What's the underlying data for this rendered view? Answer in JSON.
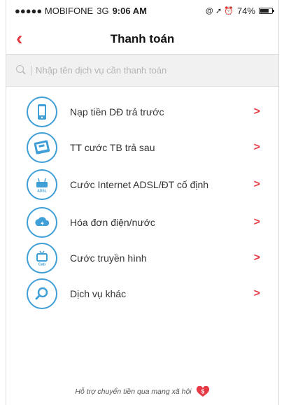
{
  "status": {
    "carrier": "●●●●● MOBIFONE",
    "network": "3G",
    "time": "9:06 AM",
    "icons": "@ ➚ ⏰",
    "battery": "74%",
    "battery_level": 0.74
  },
  "header": {
    "title": "Thanh toán",
    "back_icon": "chevron-left-icon"
  },
  "search": {
    "placeholder": "Nhập tên dịch vụ cần thanh toán"
  },
  "menu": [
    {
      "label": "Nạp tiền DĐ trả trước",
      "icon": "phone-icon"
    },
    {
      "label": "TT cước TB trả sau",
      "icon": "tablet-icon"
    },
    {
      "label": "Cước Internet ADSL/ĐT cố định",
      "icon": "adsl-icon",
      "icon_text": "ADSL"
    },
    {
      "label": "Hóa đơn điện/nước",
      "icon": "cloud-icon"
    },
    {
      "label": "Cước truyền hình",
      "icon": "tv-cab-icon",
      "icon_text": "Cab"
    },
    {
      "label": "Dịch vụ khác",
      "icon": "search-icon"
    }
  ],
  "chevron": ">",
  "footer": {
    "text": "Hỗ trợ chuyển tiền qua mạng xã hội",
    "badge": "$"
  },
  "colors": {
    "accent": "#e53945",
    "icon_blue": "#3f9fd6"
  }
}
